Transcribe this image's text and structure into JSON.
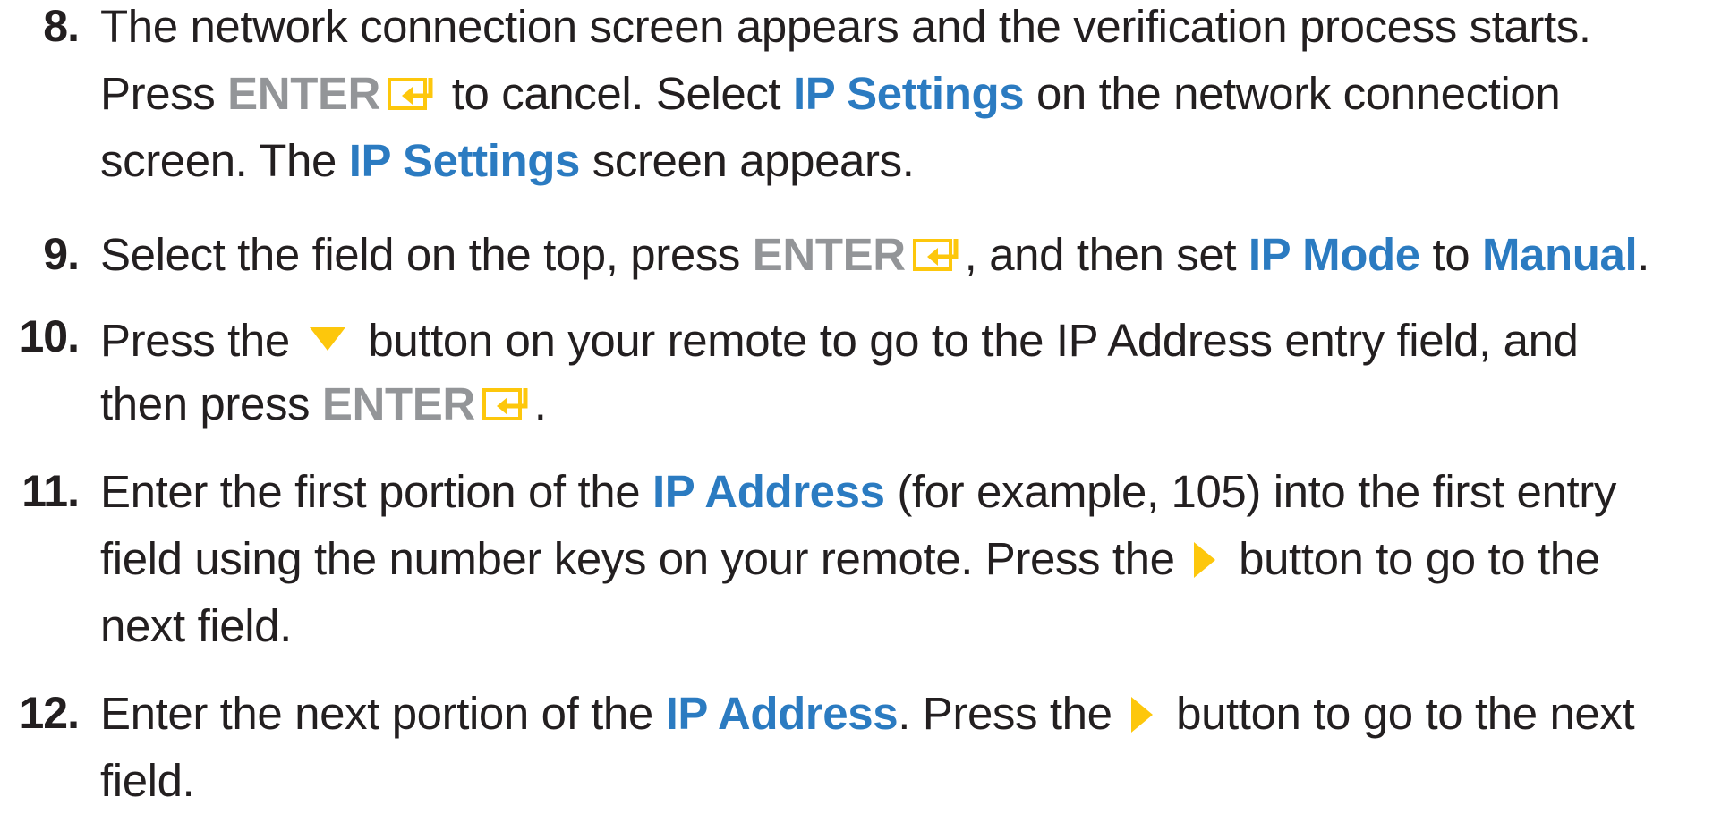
{
  "steps": [
    {
      "number": "8.",
      "lines": [
        [
          "The network connection screen appears and the verification process starts."
        ],
        [
          "Press ",
          "ENTER",
          " to cancel. Select ",
          "IP Settings",
          " on the network connection"
        ],
        [
          "screen. The ",
          "IP Settings",
          " screen appears."
        ]
      ]
    },
    {
      "number": "9.",
      "lines": [
        [
          "Select the field on the top, press ",
          "ENTER",
          ", and then set ",
          "IP Mode",
          " to ",
          "Manual",
          "."
        ]
      ]
    },
    {
      "number": "10.",
      "lines": [
        [
          "Press the ",
          " button on your remote to go to the IP Address entry field, and"
        ],
        [
          "then press ",
          "ENTER",
          "."
        ]
      ]
    },
    {
      "number": "11.",
      "lines": [
        [
          "Enter the first portion of the ",
          "IP Address",
          " (for example, 105) into the first entry"
        ],
        [
          "field using the number keys on your remote. Press the ",
          " button to go to the"
        ],
        [
          "next field."
        ]
      ]
    },
    {
      "number": "12.",
      "lines": [
        [
          "Enter the next portion of the ",
          "IP Address",
          ". Press the ",
          " button to go to the next"
        ],
        [
          "field."
        ]
      ]
    }
  ],
  "icons": {
    "enter": "enter-key-icon",
    "down": "down-arrow-icon",
    "right": "right-arrow-icon"
  },
  "colors": {
    "highlight": "#2b7bc1",
    "key": "#939598",
    "icon": "#fdc70c",
    "text": "#231f20"
  }
}
